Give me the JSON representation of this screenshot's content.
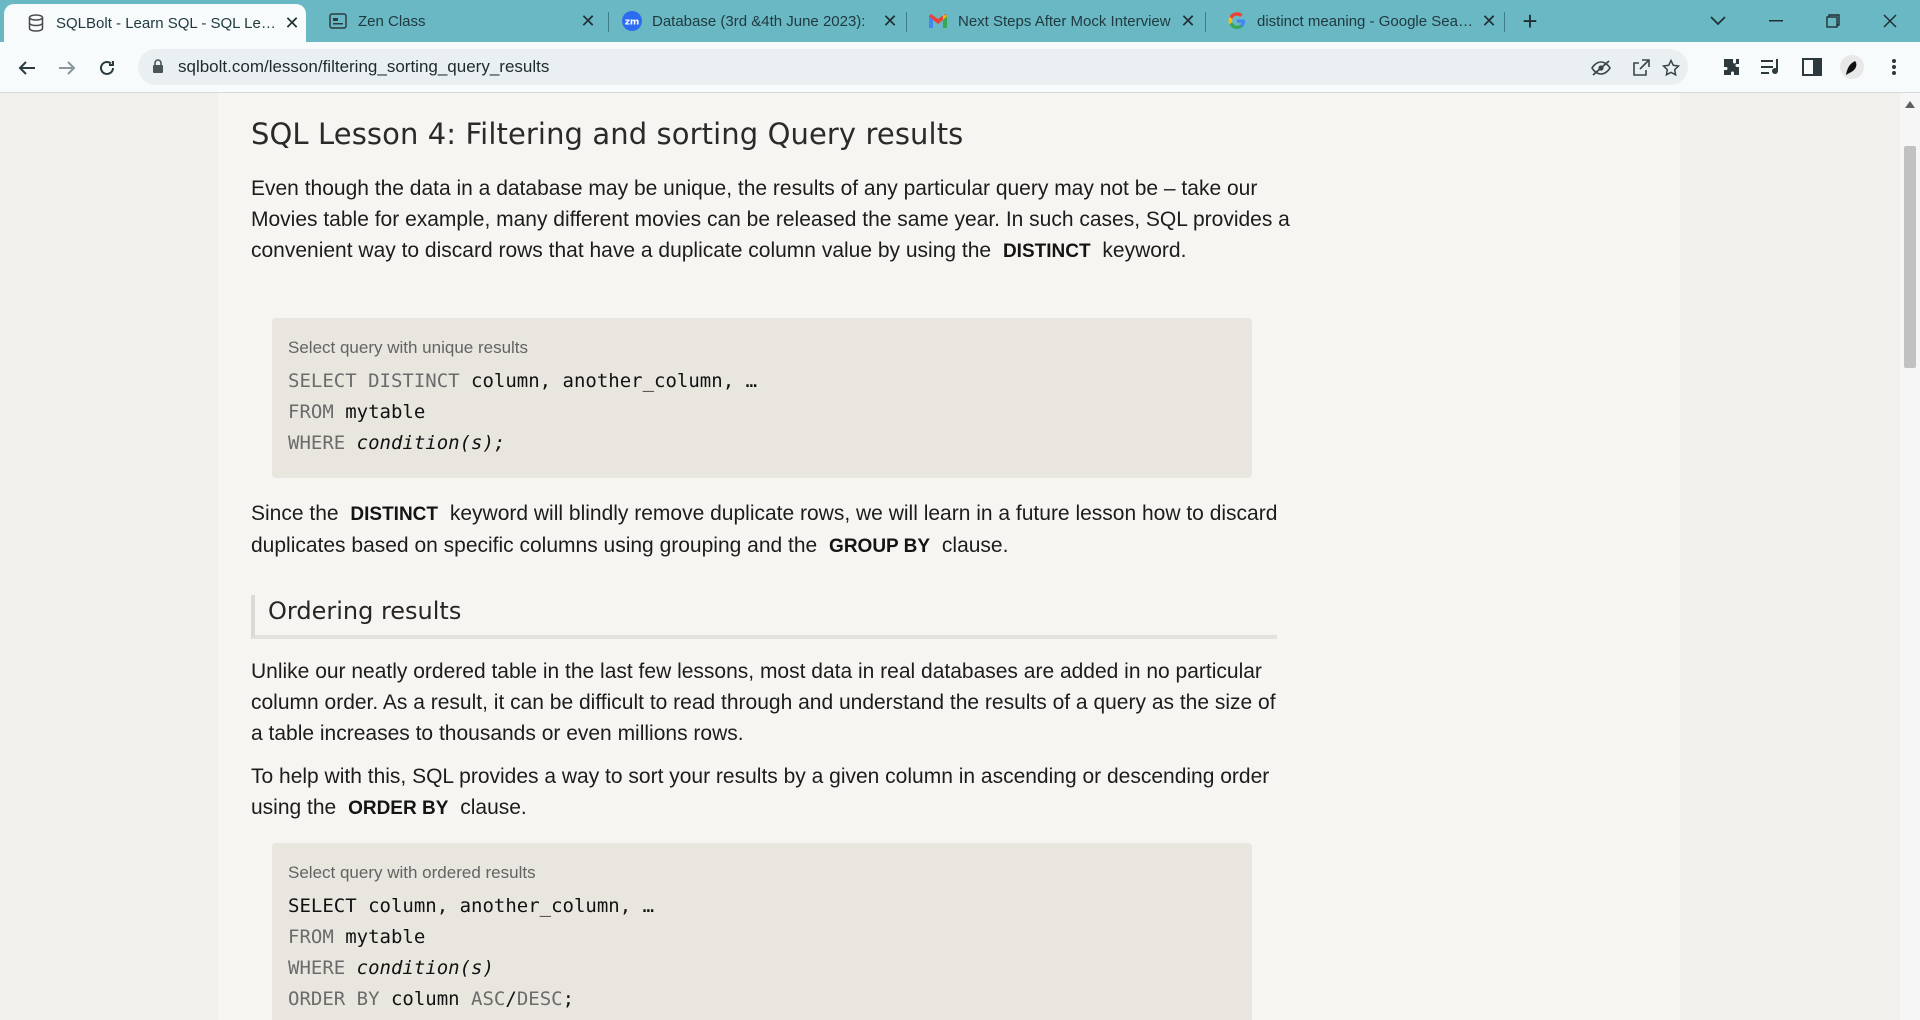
{
  "browser": {
    "tabs": [
      {
        "title": "SQLBolt - Learn SQL - SQL Lesson",
        "favicon": "database-icon",
        "active": true
      },
      {
        "title": "Zen Class",
        "favicon": "zen-class-icon",
        "active": false
      },
      {
        "title": "Database (3rd &4th June 2023):",
        "favicon": "zoom-icon",
        "active": false
      },
      {
        "title": "Next Steps After Mock Interview",
        "favicon": "gmail-icon",
        "active": false
      },
      {
        "title": "distinct meaning - Google Search",
        "favicon": "google-icon",
        "active": false
      }
    ],
    "new_tab": "+",
    "url": "sqlbolt.com/lesson/filtering_sorting_query_results",
    "colors": {
      "tabstrip": "#6bb8c5",
      "toolbar": "#f7fbfc"
    }
  },
  "lesson": {
    "title": "SQL Lesson 4: Filtering and sorting Query results",
    "p1": {
      "text": "Even though the data in a database may be unique, the results of any particular query may not be – take our Movies table for example, many different movies can be released the same year. In such cases, SQL provides a convenient way to discard rows that have a duplicate column value by using the",
      "keyword": "DISTINCT",
      "after": "keyword."
    },
    "code1": {
      "caption": "Select query with unique results",
      "lines": [
        {
          "kw": "SELECT DISTINCT",
          "rest": " column, another_column, …"
        },
        {
          "kw": "FROM",
          "rest": " mytable"
        },
        {
          "kw": "WHERE",
          "rest_italic": " condition(s);"
        }
      ]
    },
    "p2": {
      "before": "Since the",
      "keyword1": "DISTINCT",
      "middle": "keyword will blindly remove duplicate rows, we will learn in a future lesson how to discard duplicates based on specific columns using grouping and the",
      "keyword2": "GROUP BY",
      "after": "clause."
    },
    "section_title": "Ordering results",
    "p3": "Unlike our neatly ordered table in the last few lessons, most data in real databases are added in no particular column order. As a result, it can be difficult to read through and understand the results of a query as the size of a table increases to thousands or even millions rows.",
    "p4": {
      "before": "To help with this, SQL provides a way to sort your results by a given column in ascending or descending order using the",
      "keyword": "ORDER BY",
      "after": "clause."
    },
    "code2": {
      "caption": "Select query with ordered results",
      "line1_kw": "SELECT",
      "line1_rest": " column, another_column, …",
      "line2_kw": "FROM",
      "line2_rest": " mytable",
      "line3_kw": "WHERE",
      "line3_rest": " condition(s)",
      "line4_kw": "ORDER BY",
      "line4_rest": " column",
      "line4_kw2": " ASC",
      "line4_sep": "/",
      "line4_kw3": "DESC",
      "line4_end": ";"
    }
  }
}
